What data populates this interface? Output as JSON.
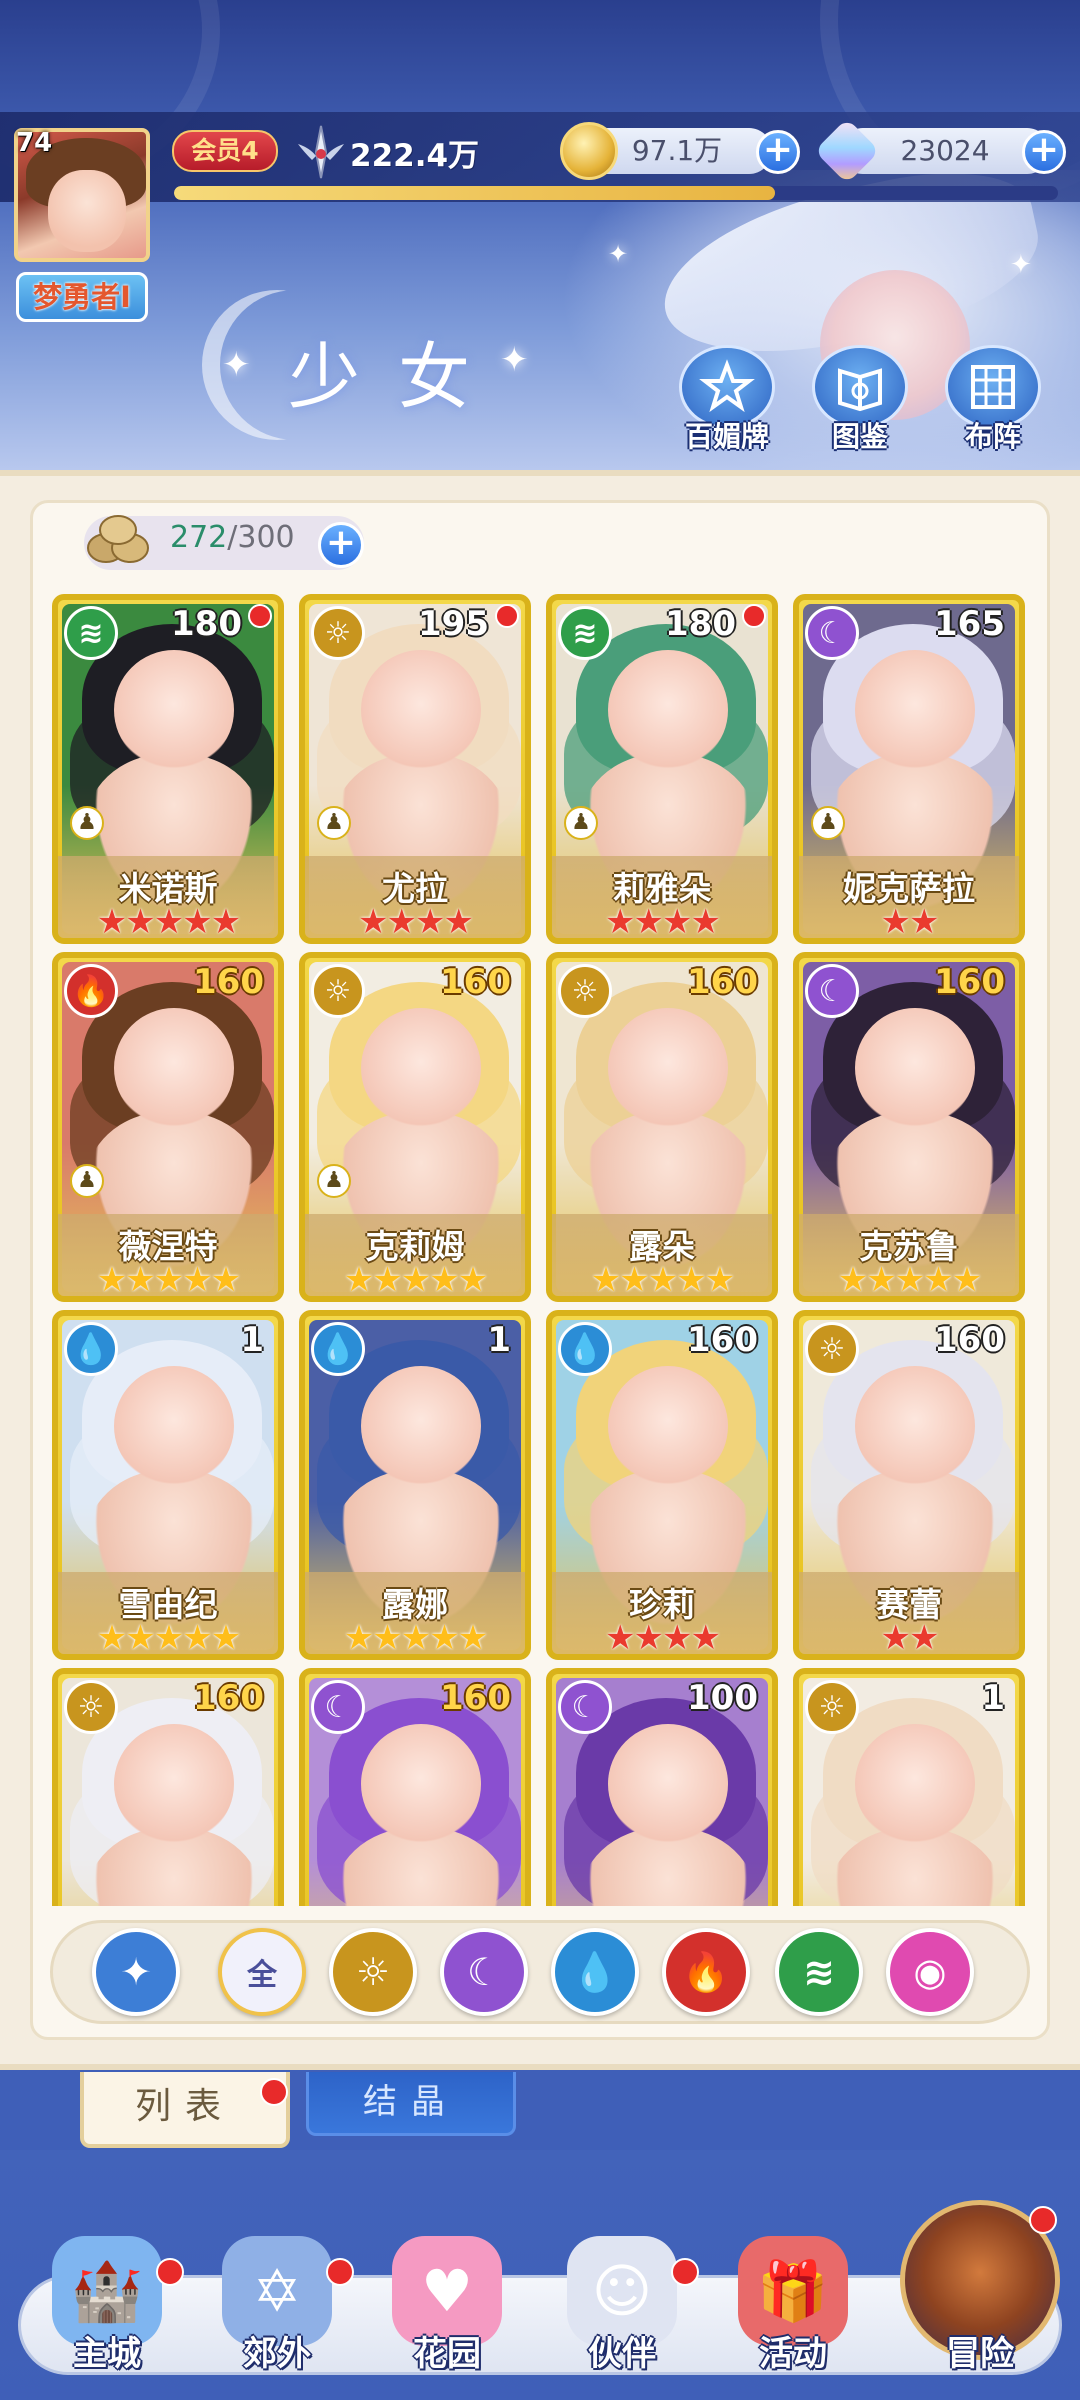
{
  "player": {
    "level": "74",
    "name": "梦勇者I",
    "vip": "会员4",
    "power": "222.4万",
    "exp_fraction": 0.68
  },
  "currency": {
    "gold": "97.1万",
    "gems": "23024"
  },
  "page": {
    "title": "少女"
  },
  "header_buttons": [
    {
      "label": "百媚牌",
      "icon": "star-card-icon"
    },
    {
      "label": "图鉴",
      "icon": "book-icon"
    },
    {
      "label": "布阵",
      "icon": "grid-formation-icon"
    }
  ],
  "capacity": {
    "current": "272",
    "max": "/300"
  },
  "elements": {
    "wind": {
      "color": "#2f9e4a",
      "glyph": "≋"
    },
    "light": {
      "color": "#c8951e",
      "glyph": "☼"
    },
    "dark": {
      "color": "#8f52d0",
      "glyph": "☾"
    },
    "water": {
      "color": "#2b8dd6",
      "glyph": "💧"
    },
    "fire": {
      "color": "#d3302c",
      "glyph": "🔥"
    },
    "all": {
      "color": "#f1f1fb",
      "glyph": "全"
    },
    "special": {
      "color": "#e04ab0",
      "glyph": "◉"
    },
    "star": {
      "color": "#3d7ed6",
      "glyph": "✦"
    }
  },
  "characters": [
    {
      "name": "米诺斯",
      "element": "wind",
      "level": "180",
      "stars": 5,
      "star_color": "red",
      "dot": true,
      "pawn": true,
      "hair": "#1e1e24",
      "bg": "#3b8a3f"
    },
    {
      "name": "尤拉",
      "element": "light",
      "level": "195",
      "stars": 4,
      "star_color": "red",
      "dot": true,
      "pawn": true,
      "hair": "#f1dcc0",
      "bg": "#efe5d6"
    },
    {
      "name": "莉雅朵",
      "element": "wind",
      "level": "180",
      "stars": 4,
      "star_color": "red",
      "dot": true,
      "pawn": true,
      "hair": "#4a9e7a",
      "bg": "#e9e2d2"
    },
    {
      "name": "妮克萨拉",
      "element": "dark",
      "level": "165",
      "stars": 2,
      "star_color": "red",
      "dot": false,
      "pawn": true,
      "hair": "#dcdcf0",
      "bg": "#6e6a8e"
    },
    {
      "name": "薇涅特",
      "element": "fire",
      "level": "160",
      "stars": 5,
      "star_color": "gold",
      "dot": false,
      "pawn": true,
      "hair": "#6b3e22",
      "bg": "#d97a6a",
      "gold_level": true
    },
    {
      "name": "克莉姆",
      "element": "light",
      "level": "160",
      "stars": 5,
      "star_color": "gold",
      "dot": false,
      "pawn": true,
      "hair": "#f4d783",
      "bg": "#f2ede2",
      "gold_level": true
    },
    {
      "name": "露朵",
      "element": "light",
      "level": "160",
      "stars": 5,
      "star_color": "gold",
      "dot": false,
      "pawn": false,
      "hair": "#ecd095",
      "bg": "#efe6d2",
      "gold_level": true
    },
    {
      "name": "克苏鲁",
      "element": "dark",
      "level": "160",
      "stars": 5,
      "star_color": "gold",
      "dot": false,
      "pawn": false,
      "hair": "#2e2238",
      "bg": "#7d5ea6",
      "gold_level": true
    },
    {
      "name": "雪由纪",
      "element": "water",
      "level": "1",
      "stars": 5,
      "star_color": "gold",
      "dot": false,
      "pawn": false,
      "hair": "#e6edf8",
      "bg": "#cfdff0"
    },
    {
      "name": "露娜",
      "element": "water",
      "level": "1",
      "stars": 5,
      "star_color": "gold",
      "dot": false,
      "pawn": false,
      "hair": "#3a5aa8",
      "bg": "#4b5fa6"
    },
    {
      "name": "珍莉",
      "element": "water",
      "level": "160",
      "stars": 4,
      "star_color": "red",
      "dot": false,
      "pawn": false,
      "hair": "#f1d37a",
      "bg": "#9fd2e6"
    },
    {
      "name": "赛蕾",
      "element": "light",
      "level": "160",
      "stars": 2,
      "star_color": "red",
      "dot": false,
      "pawn": false,
      "hair": "#e4e4ee",
      "bg": "#efe9da"
    },
    {
      "name": "",
      "element": "light",
      "level": "160",
      "stars": 0,
      "star_color": "gold",
      "dot": false,
      "pawn": false,
      "hair": "#eeeef4",
      "bg": "#ece6da",
      "gold_level": true
    },
    {
      "name": "",
      "element": "dark",
      "level": "160",
      "stars": 0,
      "star_color": "gold",
      "dot": false,
      "pawn": false,
      "hair": "#8a4fd0",
      "bg": "#b48fd8",
      "gold_level": true
    },
    {
      "name": "",
      "element": "dark",
      "level": "100",
      "stars": 0,
      "star_color": "gold",
      "dot": false,
      "pawn": false,
      "hair": "#6a3aa8",
      "bg": "#a67fcf"
    },
    {
      "name": "",
      "element": "light",
      "level": "1",
      "stars": 0,
      "star_color": "gold",
      "dot": false,
      "pawn": false,
      "hair": "#f0dcc4",
      "bg": "#f2ece2"
    }
  ],
  "filters": [
    {
      "key": "star",
      "selected": false
    },
    {
      "key": "all",
      "selected": true
    },
    {
      "key": "light",
      "selected": false
    },
    {
      "key": "dark",
      "selected": false
    },
    {
      "key": "water",
      "selected": false
    },
    {
      "key": "fire",
      "selected": false
    },
    {
      "key": "wind",
      "selected": false
    },
    {
      "key": "special",
      "selected": false
    }
  ],
  "tabs": {
    "list": "列表",
    "crystal": "结晶"
  },
  "nav": [
    {
      "label": "主城",
      "icon": "castle-icon",
      "dot": true
    },
    {
      "label": "郊外",
      "icon": "portal-icon",
      "dot": true
    },
    {
      "label": "花园",
      "icon": "heart-icon",
      "dot": false
    },
    {
      "label": "伙伴",
      "icon": "partner-icon",
      "dot": true
    },
    {
      "label": "活动",
      "icon": "gift-icon",
      "dot": false
    },
    {
      "label": "冒险",
      "icon": "compass-icon",
      "dot": true
    }
  ]
}
